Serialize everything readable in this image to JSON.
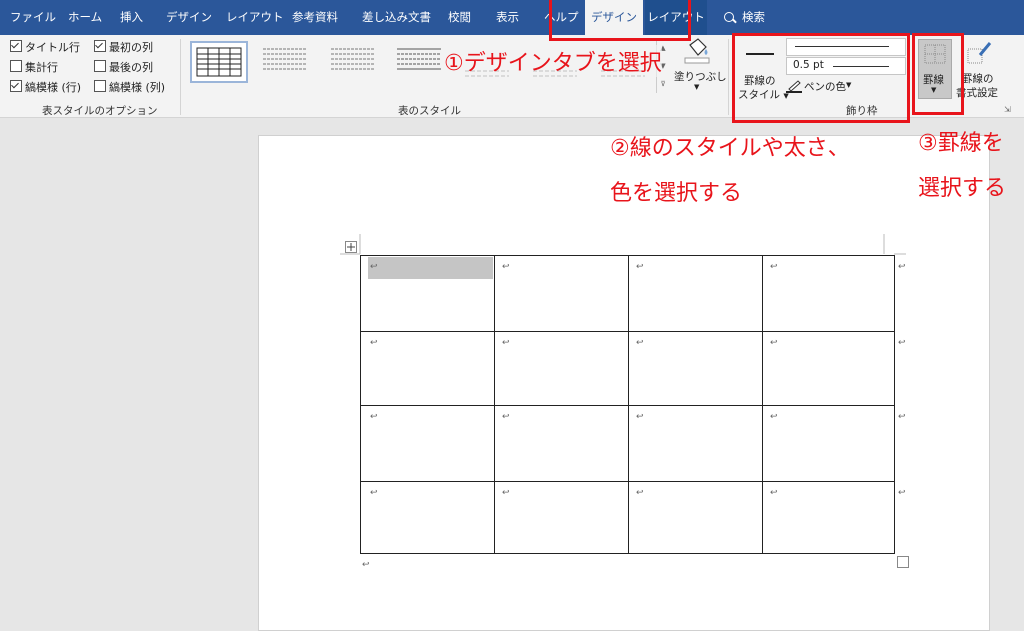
{
  "tabs": [
    "ファイル",
    "ホーム",
    "挿入",
    "デザイン",
    "レイアウト",
    "参考資料",
    "差し込み文書",
    "校閲",
    "表示",
    "ヘルプ",
    "デザイン",
    "レイアウト"
  ],
  "search_label": "検索",
  "options": {
    "title_row": "タイトル行",
    "total_row": "集計行",
    "banded_rows": "縞模様 (行)",
    "first_col": "最初の列",
    "last_col": "最後の列",
    "banded_cols": "縞模様 (列)",
    "group_label": "表スタイルのオプション"
  },
  "styles": {
    "group_label": "表のスタイル",
    "shading_label": "塗りつぶし"
  },
  "borders": {
    "border_style_label1": "罫線の",
    "border_style_label2": "スタイル",
    "pen_weight": "0.5 pt",
    "pen_color_label": "ペンの色",
    "group_label": "飾り枠",
    "borders_label": "罫線",
    "painter_label1": "罫線の",
    "painter_label2": "書式設定"
  },
  "annotations": {
    "a1": "①デザインタブを選択",
    "a2_line1": "②線のスタイルや太さ、",
    "a2_line2": "色を選択する",
    "a3_line1": "③罫線を",
    "a3_line2": "選択する"
  },
  "colors": {
    "ribbon_blue": "#2b579a",
    "annotation_red": "#e8141b"
  }
}
